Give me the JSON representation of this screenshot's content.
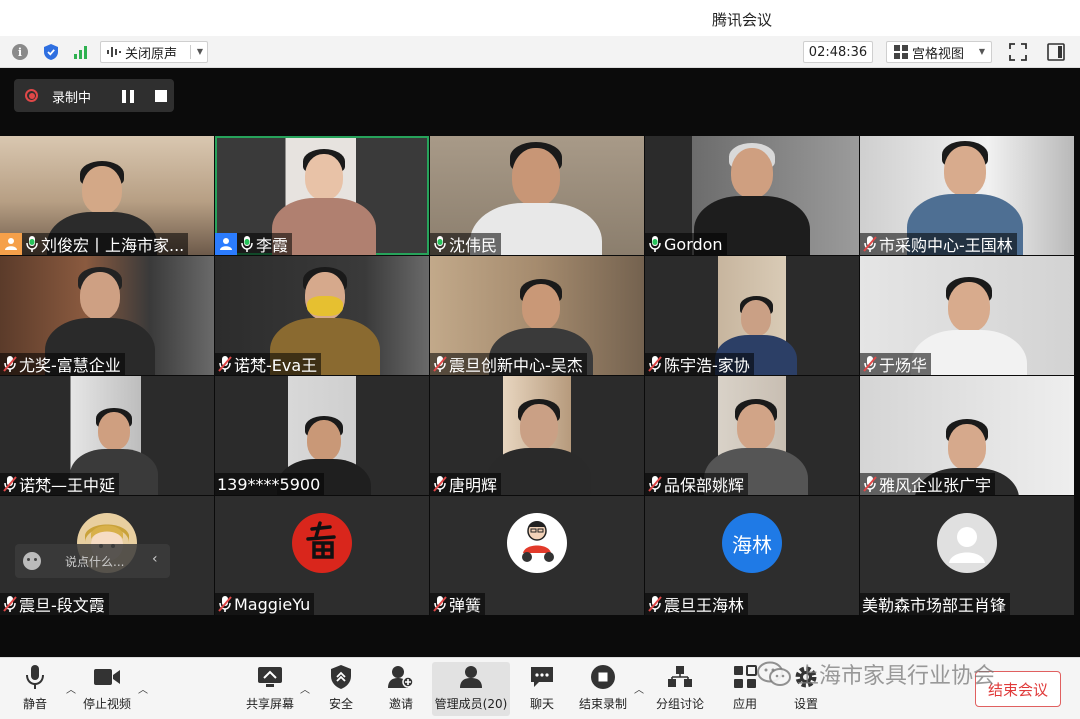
{
  "window": {
    "title": "腾讯会议"
  },
  "infobar": {
    "original_sound_label": "关闭原声",
    "timer": "02:48:36",
    "view_mode_label": "宫格视图"
  },
  "recording": {
    "label": "录制中"
  },
  "participants": [
    {
      "name": "刘俊宏丨上海市家...",
      "role": "host",
      "mic": "on"
    },
    {
      "name": "李霞",
      "role": "cohost",
      "mic": "on",
      "speaking": true
    },
    {
      "name": "沈伟民",
      "mic": "on"
    },
    {
      "name": "Gordon",
      "mic": "on"
    },
    {
      "name": "市采购中心-王国林",
      "mic": "muted"
    },
    {
      "name": "尤奖-富慧企业",
      "mic": "muted"
    },
    {
      "name": "诺梵-Eva王",
      "mic": "muted"
    },
    {
      "name": "震旦创新中心-吴杰",
      "mic": "muted"
    },
    {
      "name": "陈宇浩-家协",
      "mic": "muted"
    },
    {
      "name": "于炀华",
      "mic": "muted"
    },
    {
      "name": "诺梵—王中延",
      "mic": "muted"
    },
    {
      "name": "139****5900",
      "mic": "none"
    },
    {
      "name": "唐明辉",
      "mic": "muted"
    },
    {
      "name": "品保部姚辉",
      "mic": "muted"
    },
    {
      "name": "雅风企业张广宇",
      "mic": "muted"
    },
    {
      "name": "震旦-段文霞",
      "mic": "muted"
    },
    {
      "name": "MaggieYu",
      "mic": "muted"
    },
    {
      "name": "弹簧",
      "mic": "muted"
    },
    {
      "name": "震旦王海林",
      "mic": "muted",
      "avatar_text": "海林"
    },
    {
      "name": "美勒森市场部王肖锋",
      "mic": "none"
    }
  ],
  "chat_overlay": {
    "placeholder": "说点什么..."
  },
  "toolbar": {
    "mute": "静音",
    "stop_video": "停止视频",
    "share_screen": "共享屏幕",
    "security": "安全",
    "invite": "邀请",
    "manage_members": "管理成员(20)",
    "chat": "聊天",
    "end_recording": "结束录制",
    "breakout": "分组讨论",
    "apps": "应用",
    "settings": "设置",
    "end_meeting": "结束会议"
  },
  "watermark": {
    "text": "上海市家具行业协会"
  },
  "colors": {
    "speaking_outline": "#27a35b",
    "host_badge": "#f5a04a",
    "cohost_badge": "#2b7cff",
    "muted_mic": "#e04848",
    "end_button": "#e03a3a"
  }
}
